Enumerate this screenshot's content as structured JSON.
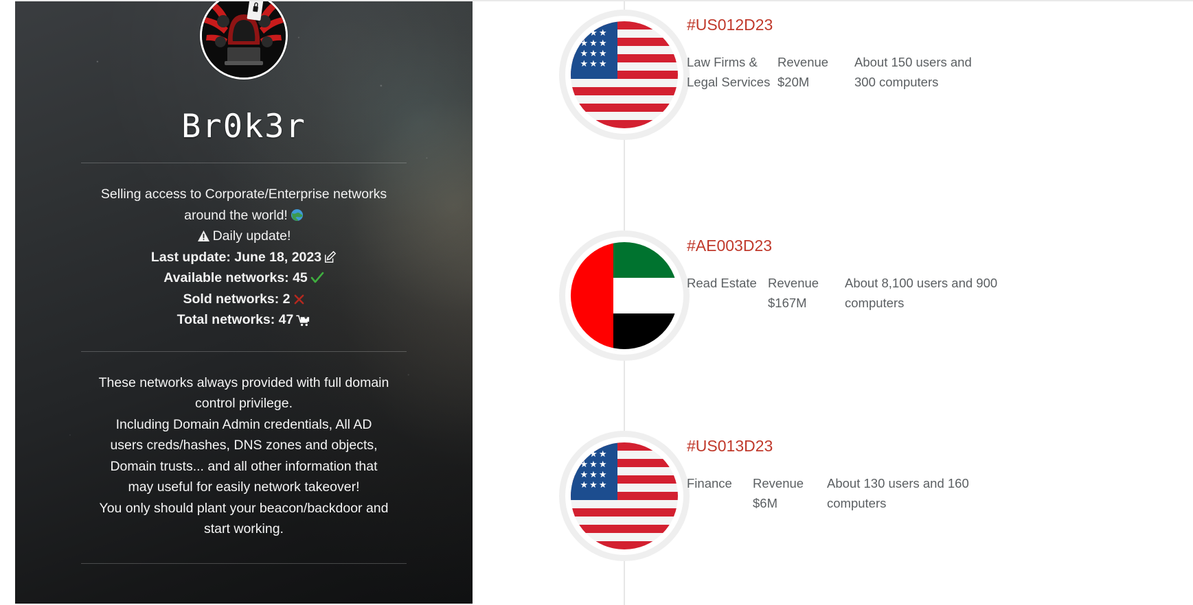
{
  "profile": {
    "avatar_icon": "hooded-hacker-avatar",
    "handle": "Br0k3r",
    "tagline_line1": "Selling access to Corporate/Enterprise networks",
    "tagline_line2": "around the world!",
    "globe_icon": "globe-emoji",
    "warning_icon": "warning-triangle-icon",
    "daily_update": "Daily update!",
    "last_update_label": "Last update: June 18, 2023",
    "pencil_icon": "pencil-edit-icon",
    "available_label": "Available networks: 45",
    "check_icon": "green-check-icon",
    "sold_label": "Sold networks: 2",
    "cross_icon": "red-cross-icon",
    "total_label": "Total networks: 47",
    "cart_icon": "shopping-cart-add-icon",
    "details_line1": "These networks always provided with full domain",
    "details_line2": "control privilege.",
    "details_line3": "Including Domain Admin credentials, All AD",
    "details_line4": "users creds/hashes, DNS zones and objects,",
    "details_line5": "Domain trusts... and all other information that",
    "details_line6": "may useful for easily network takeover!",
    "details_line7": "You only should plant your beacon/backdoor and",
    "details_line8": "start working."
  },
  "colors": {
    "accent_red": "#c0392b",
    "sidebar_dark": "#2f3234",
    "timeline_line": "#e6e6e6",
    "badge_ring": "#efefef",
    "body_text": "#5b5f62",
    "check_green": "#3fae3f",
    "cross_red": "#c0392b"
  },
  "timeline": {
    "items": [
      {
        "id": "#US012D23",
        "flag": "flag-us",
        "flag_name": "united-states-flag",
        "sector": "Law Firms & Legal Services",
        "revenue": "Revenue $20M",
        "scale": "About 150 users and 300 computers"
      },
      {
        "id": "#AE003D23",
        "flag": "flag-ae",
        "flag_name": "united-arab-emirates-flag",
        "sector": "Read Estate",
        "revenue": "Revenue $167M",
        "scale": "About 8,100 users and 900 computers"
      },
      {
        "id": "#US013D23",
        "flag": "flag-us",
        "flag_name": "united-states-flag",
        "sector": "Finance",
        "revenue": "Revenue $6M",
        "scale": "About 130 users and 160 computers"
      }
    ]
  }
}
